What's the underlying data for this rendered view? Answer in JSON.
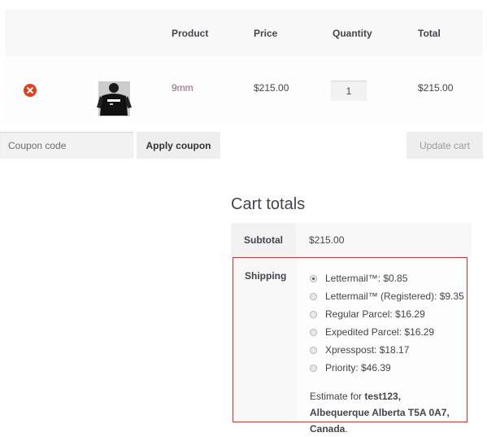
{
  "cart": {
    "columns": {
      "product": "Product",
      "price": "Price",
      "quantity": "Quantity",
      "total": "Total"
    },
    "items": [
      {
        "name": "9mm",
        "price": "$215.00",
        "quantity": "1",
        "total": "$215.00",
        "remove_icon": "remove-x-icon",
        "thumbnail": "product-photo-person-in-black-tshirt"
      }
    ]
  },
  "coupon": {
    "placeholder": "Coupon code",
    "apply_label": "Apply coupon"
  },
  "update_cart_label": "Update cart",
  "totals": {
    "title": "Cart totals",
    "subtotal_label": "Subtotal",
    "subtotal_value": "$215.00",
    "shipping_label": "Shipping",
    "shipping_options": [
      {
        "label": "Lettermail™: $0.85",
        "selected": true
      },
      {
        "label": "Lettermail™ (Registered): $9.35",
        "selected": false
      },
      {
        "label": "Regular Parcel: $16.29",
        "selected": false
      },
      {
        "label": "Expedited Parcel: $16.29",
        "selected": false
      },
      {
        "label": "Xpresspost: $18.17",
        "selected": false
      },
      {
        "label": "Priority: $46.39",
        "selected": false
      }
    ],
    "estimate_prefix": "Estimate for ",
    "estimate_address": "test123, Albequerque Alberta T5A 0A7, Canada",
    "estimate_suffix": "."
  },
  "colors": {
    "link": "#96588a",
    "remove": "#e2401c",
    "highlight_border": "#c0393b"
  }
}
